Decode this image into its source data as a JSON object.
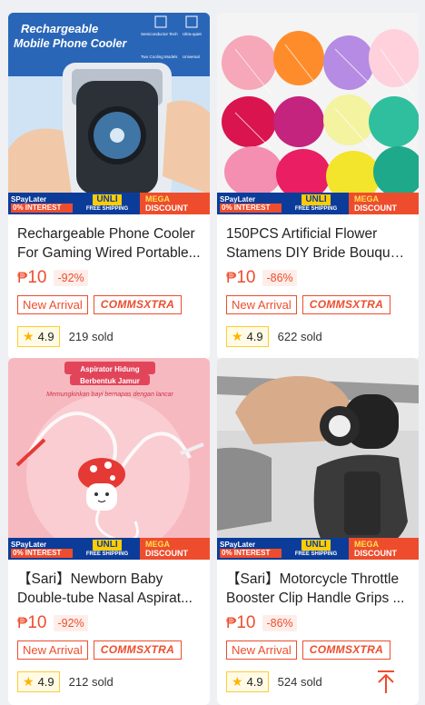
{
  "promo": {
    "spaylater": "SPayLater",
    "interest": "0% INTEREST",
    "unli": "UNLI",
    "free_shipping": "FREE SHIPPING",
    "mega": "MEGA",
    "discount": "DISCOUNT"
  },
  "tags": {
    "new_arrival": "New Arrival",
    "comms": "COMMSXTRA"
  },
  "currency": "₱",
  "products": [
    {
      "title_line1": "Rechargeable Phone Cooler",
      "title_line2": "For Gaming Wired Portable...",
      "price": "10",
      "discount": "-92%",
      "rating": "4.9",
      "sold": "219 sold",
      "image_text": {
        "line1": "Rechargeable",
        "line2": "Mobile Phone Cooler",
        "f1": "Semiconductor Tech",
        "f2": "Ultra-quiet",
        "f3": "Two Cooling Models",
        "f4": "Universal"
      }
    },
    {
      "title_line1": "150PCS Artificial Flower",
      "title_line2": "Stamens DIY Bride Bouque...",
      "price": "10",
      "discount": "-86%",
      "rating": "4.9",
      "sold": "622 sold"
    },
    {
      "title_line1": "【Sari】Newborn Baby",
      "title_line2": "Double-tube Nasal Aspirat...",
      "price": "10",
      "discount": "-92%",
      "rating": "4.9",
      "sold": "212 sold",
      "image_text": {
        "line1": "Aspirator Hidung",
        "line2": "Berbentuk Jamur",
        "line3": "Memungkinkan bayi bernapas dengan lancar"
      }
    },
    {
      "title_line1": "【Sari】Motorcycle Throttle",
      "title_line2": "Booster Clip Handle Grips ...",
      "price": "10",
      "discount": "-86%",
      "rating": "4.9",
      "sold": "524 sold"
    }
  ],
  "colors": {
    "accent": "#ee4d2d",
    "star": "#ffb300",
    "background": "#eef0f3"
  }
}
